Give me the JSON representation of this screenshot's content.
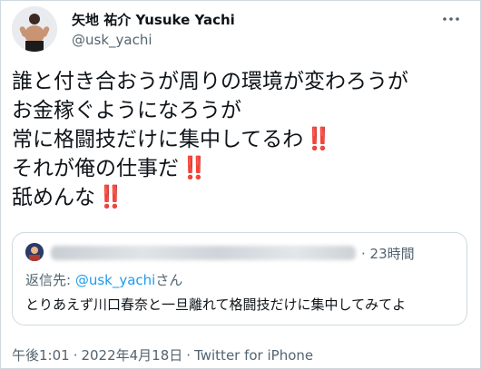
{
  "author": {
    "display_name": "矢地 祐介 Yusuke Yachi",
    "handle": "@usk_yachi"
  },
  "tweet": {
    "lines": [
      {
        "text": "誰と付き合おうが周りの環境が変わろうが",
        "emoji": ""
      },
      {
        "text": "お金稼ぐようになろうが",
        "emoji": ""
      },
      {
        "text": "常に格闘技だけに集中してるわ",
        "emoji": "‼️"
      },
      {
        "text": "それが俺の仕事だ",
        "emoji": "‼️"
      },
      {
        "text": "舐めんな",
        "emoji": "‼️"
      }
    ]
  },
  "quoted": {
    "timestamp": "· 23時間",
    "reply_prefix": "返信先: ",
    "reply_handle": "@usk_yachi",
    "reply_suffix": "さん",
    "text": "とりあえず川口春奈と一旦離れて格闘技だけに集中してみてよ"
  },
  "meta": {
    "time": "午後1:01",
    "separator": "·",
    "date": "2022年4月18日",
    "source": "Twitter for iPhone"
  },
  "icons": {
    "more": "more-horizontal-icon"
  }
}
